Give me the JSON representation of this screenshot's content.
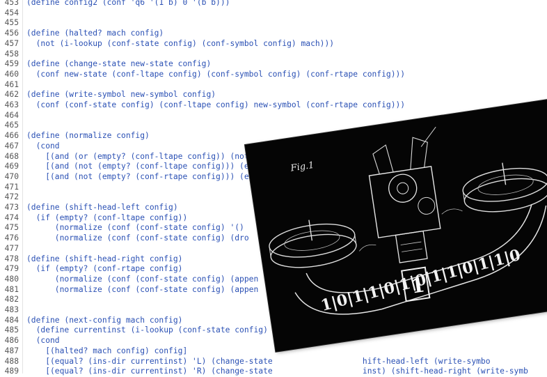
{
  "editor": {
    "lines": [
      {
        "n": "453",
        "text": "(define config2 (conf 'q6 '(1 b) 0 '(b b)))"
      },
      {
        "n": "454",
        "text": ""
      },
      {
        "n": "455",
        "text": ""
      },
      {
        "n": "456",
        "text": "(define (halted? mach config)"
      },
      {
        "n": "457",
        "text": "  (not (i-lookup (conf-state config) (conf-symbol config) mach)))"
      },
      {
        "n": "458",
        "text": ""
      },
      {
        "n": "459",
        "text": "(define (change-state new-state config)"
      },
      {
        "n": "460",
        "text": "  (conf new-state (conf-ltape config) (conf-symbol config) (conf-rtape config)))"
      },
      {
        "n": "461",
        "text": ""
      },
      {
        "n": "462",
        "text": "(define (write-symbol new-symbol config)"
      },
      {
        "n": "463",
        "text": "  (conf (conf-state config) (conf-ltape config) new-symbol (conf-rtape config)))"
      },
      {
        "n": "464",
        "text": ""
      },
      {
        "n": "465",
        "text": ""
      },
      {
        "n": "466",
        "text": "(define (normalize config)"
      },
      {
        "n": "467",
        "text": "  (cond"
      },
      {
        "n": "468",
        "text": "    [(and (or (empty? (conf-ltape config)) (not (equal? (car (conf-ltape config)) 'b))) (or (      (conf-rt"
      },
      {
        "n": "469",
        "text": "    [(and (not (empty? (conf-ltape config))) (equal? (car (conf-ltape config)) 'b))            (conf-s"
      },
      {
        "n": "470",
        "text": "    [(and (not (empty? (conf-rtape config))) (equal? (last (conf-rtape                         (conf-"
      },
      {
        "n": "471",
        "text": ""
      },
      {
        "n": "472",
        "text": ""
      },
      {
        "n": "473",
        "text": "(define (shift-head-left config)"
      },
      {
        "n": "474",
        "text": "  (if (empty? (conf-ltape config))"
      },
      {
        "n": "475",
        "text": "      (normalize (conf (conf-state config) '()"
      },
      {
        "n": "476",
        "text": "      (normalize (conf (conf-state config) (dro                                              co"
      },
      {
        "n": "477",
        "text": ""
      },
      {
        "n": "478",
        "text": "(define (shift-head-right config)"
      },
      {
        "n": "479",
        "text": "  (if (empty? (conf-rtape config)"
      },
      {
        "n": "480",
        "text": "      (normalize (conf (conf-state config) (appen"
      },
      {
        "n": "481",
        "text": "      (normalize (conf (conf-state config) (appen"
      },
      {
        "n": "482",
        "text": ""
      },
      {
        "n": "483",
        "text": ""
      },
      {
        "n": "484",
        "text": "(define (next-config mach config)"
      },
      {
        "n": "485",
        "text": "  (define currentinst (i-lookup (conf-state config)"
      },
      {
        "n": "486",
        "text": "  (cond"
      },
      {
        "n": "487",
        "text": "    [(halted? mach config) config]"
      },
      {
        "n": "488",
        "text": "    [(equal? (ins-dir currentinst) 'L) (change-state                   hift-head-left (write-symbo"
      },
      {
        "n": "489",
        "text": "    [(equal? (ins-dir currentinst) 'R) (change-state                   inst) (shift-head-right (write-symb"
      }
    ]
  },
  "image": {
    "caption": "Fig.1",
    "tape_text": "1|0|1|1|0|1|0|1|1|0|1|1|0",
    "head_symbol": "1"
  }
}
